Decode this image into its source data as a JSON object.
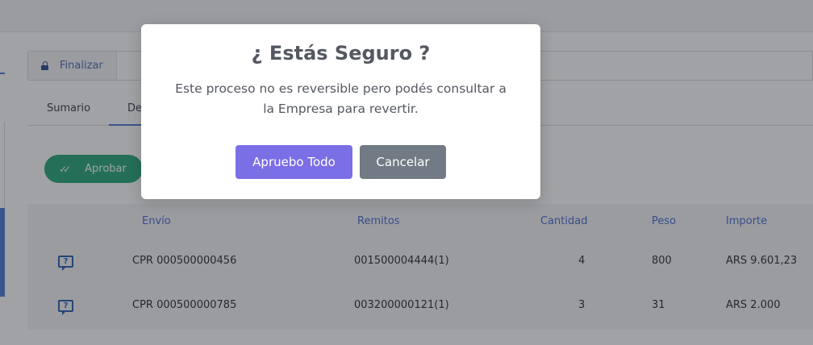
{
  "toolbar": {
    "finalizar_label": "Finalizar",
    "finalizar_icon": "lock-icon"
  },
  "tabs": [
    {
      "label": "Sumario"
    },
    {
      "label": "De"
    }
  ],
  "actions": {
    "aprobar_label": "Aprobar",
    "aprobar_icon": "double-check-icon"
  },
  "table": {
    "headers": [
      "Envío",
      "Remitos",
      "Cantidad",
      "Peso",
      "Importe"
    ],
    "rows": [
      {
        "icon": "question-chat-icon",
        "envio": "CPR 000500000456",
        "remitos": "001500004444(1)",
        "cantidad": "4",
        "peso": "800",
        "importe": "ARS 9.601,23"
      },
      {
        "icon": "question-chat-icon",
        "envio": "CPR 000500000785",
        "remitos": "003200000121(1)",
        "cantidad": "3",
        "peso": "31",
        "importe": "ARS 2.000"
      }
    ]
  },
  "modal": {
    "title": "¿ Estás Seguro ?",
    "text": "Este proceso no es reversible pero podés consultar a la Empresa para revertir.",
    "confirm_label": "Apruebo Todo",
    "cancel_label": "Cancelar"
  },
  "colors": {
    "primary_button": "#7b6fe6",
    "secondary_button": "#717a85",
    "aprobar_button": "#2aa87a",
    "accent_blue": "#4a7cd6"
  }
}
